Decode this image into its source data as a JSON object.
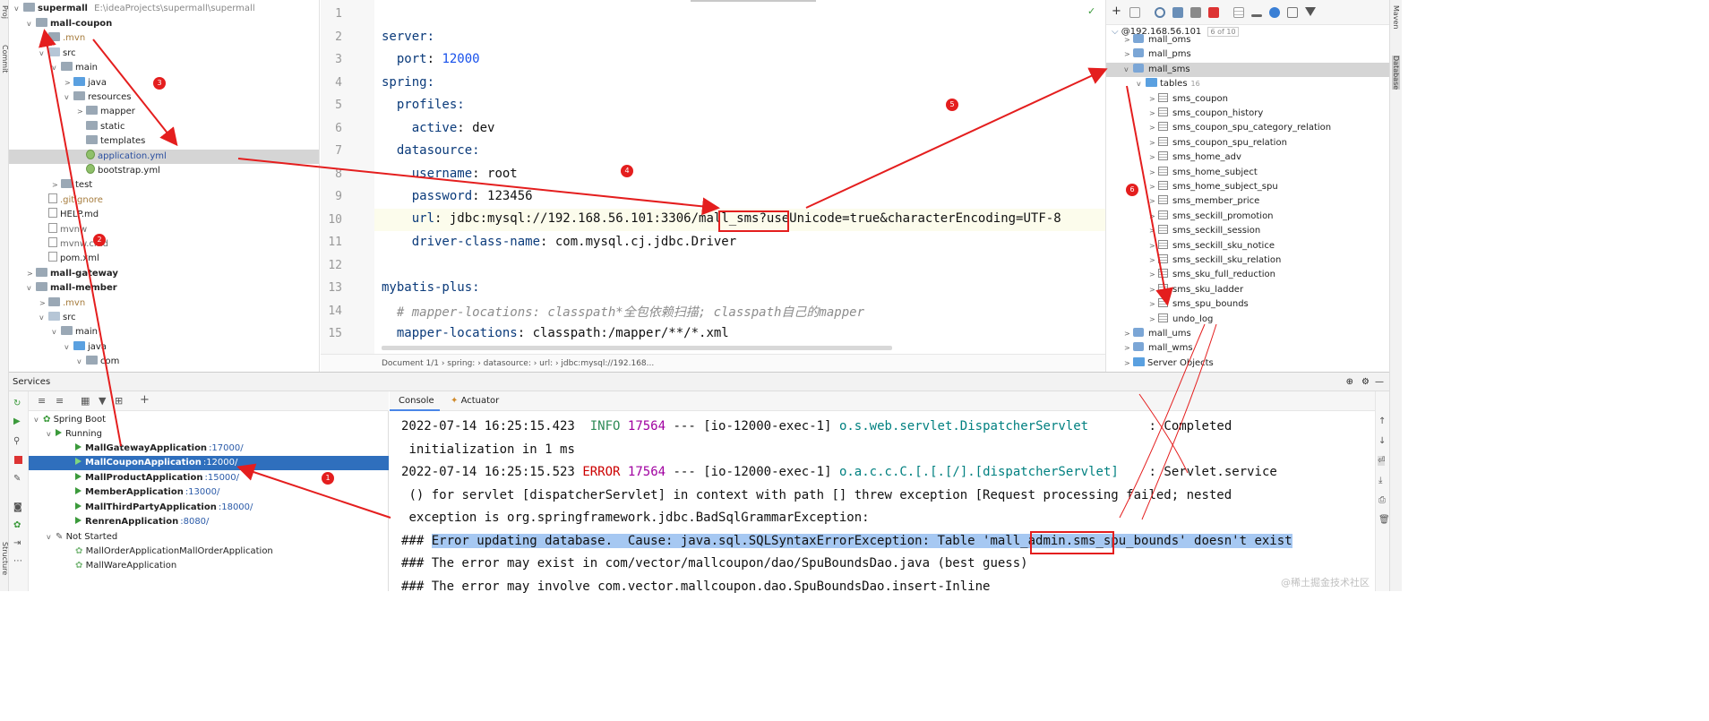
{
  "left_strip": {
    "project": "Proj",
    "commit": "Commit",
    "structure": "Structure"
  },
  "right_strip": {
    "maven": "Maven",
    "database": "Database"
  },
  "project_tree": {
    "root_name": "supermall",
    "root_path": "E:\\ideaProjects\\supermall\\supermall",
    "items": [
      {
        "label": "mall-coupon",
        "depth": 1,
        "kind": "module",
        "arrow": "v",
        "bold": true
      },
      {
        "label": ".mvn",
        "depth": 2,
        "kind": "folder",
        "arrow": "",
        "color": "#a67c3d"
      },
      {
        "label": "src",
        "depth": 2,
        "kind": "srcfolder",
        "arrow": "v"
      },
      {
        "label": "main",
        "depth": 3,
        "kind": "folder",
        "arrow": "v"
      },
      {
        "label": "java",
        "depth": 4,
        "kind": "bluefolder",
        "arrow": ">"
      },
      {
        "label": "resources",
        "depth": 4,
        "kind": "folder",
        "arrow": "v"
      },
      {
        "label": "mapper",
        "depth": 5,
        "kind": "folder",
        "arrow": ">"
      },
      {
        "label": "static",
        "depth": 5,
        "kind": "folder",
        "arrow": ""
      },
      {
        "label": "templates",
        "depth": 5,
        "kind": "folder",
        "arrow": ""
      },
      {
        "label": "application.yml",
        "depth": 5,
        "kind": "yml",
        "arrow": "",
        "selected": true,
        "color": "#2a4fa0"
      },
      {
        "label": "bootstrap.yml",
        "depth": 5,
        "kind": "yml",
        "arrow": ""
      },
      {
        "label": "test",
        "depth": 3,
        "kind": "folder",
        "arrow": ">"
      },
      {
        "label": ".gitignore",
        "depth": 2,
        "kind": "file",
        "arrow": "",
        "color": "#a67c3d"
      },
      {
        "label": "HELP.md",
        "depth": 2,
        "kind": "file",
        "arrow": ""
      },
      {
        "label": "mvnw",
        "depth": 2,
        "kind": "file",
        "arrow": "",
        "color": "#6b6b6b"
      },
      {
        "label": "mvnw.cmd",
        "depth": 2,
        "kind": "file",
        "arrow": "",
        "color": "#6b6b6b"
      },
      {
        "label": "pom.xml",
        "depth": 2,
        "kind": "file",
        "arrow": ""
      },
      {
        "label": "mall-gateway",
        "depth": 1,
        "kind": "module",
        "arrow": ">",
        "bold": true
      },
      {
        "label": "mall-member",
        "depth": 1,
        "kind": "module",
        "arrow": "v",
        "bold": true
      },
      {
        "label": ".mvn",
        "depth": 2,
        "kind": "folder",
        "arrow": ">",
        "color": "#a67c3d"
      },
      {
        "label": "src",
        "depth": 2,
        "kind": "srcfolder",
        "arrow": "v"
      },
      {
        "label": "main",
        "depth": 3,
        "kind": "folder",
        "arrow": "v"
      },
      {
        "label": "java",
        "depth": 4,
        "kind": "bluefolder",
        "arrow": "v"
      },
      {
        "label": "com",
        "depth": 5,
        "kind": "folder",
        "arrow": "v"
      }
    ]
  },
  "editor": {
    "line_numbers": [
      "1",
      "2",
      "3",
      "4",
      "5",
      "6",
      "7",
      "8",
      "9",
      "10",
      "11",
      "12",
      "13",
      "14",
      "15"
    ],
    "lines": {
      "l2": "server:",
      "l3k": "port",
      "l3v": "12000",
      "l4": "spring:",
      "l5": "profiles:",
      "l6k": "active",
      "l6v": "dev",
      "l7": "datasource:",
      "l8k": "username",
      "l8v": "root",
      "l9k": "password",
      "l9v": "123456",
      "l10k": "url",
      "l10a": "jdbc:mysql://192.168.56.101:3306/",
      "l10b": "mall_sms",
      "l10c": "?useUnicode=true&characterEncoding=UTF-8",
      "l11k": "driver-class-name",
      "l11v": "com.mysql.cj.jdbc.Driver",
      "l13": "mybatis-plus:",
      "l14": "# mapper-locations: classpath*全包依赖扫描; classpath自己的mapper",
      "l15k": "mapper-locations",
      "l15v": "classpath:/mapper/**/*.xml"
    },
    "breadcrumb": "Document 1/1  ›  spring:  ›  datasource:  ›  url:  ›  jdbc:mysql://192.168..."
  },
  "database": {
    "host": "@192.168.56.101",
    "count": "6 of 10",
    "schemas_top": [
      "mall_oms",
      "mall_pms"
    ],
    "selected_schema": "mall_sms",
    "tables_label": "tables",
    "tables_count": "16",
    "tables": [
      "sms_coupon",
      "sms_coupon_history",
      "sms_coupon_spu_category_relation",
      "sms_coupon_spu_relation",
      "sms_home_adv",
      "sms_home_subject",
      "sms_home_subject_spu",
      "sms_member_price",
      "sms_seckill_promotion",
      "sms_seckill_session",
      "sms_seckill_sku_notice",
      "sms_seckill_sku_relation",
      "sms_sku_full_reduction",
      "sms_sku_ladder",
      "sms_spu_bounds",
      "undo_log"
    ],
    "schemas_bottom": [
      "mall_ums",
      "mall_wms"
    ],
    "server_objects": "Server Objects"
  },
  "services": {
    "title": "Services",
    "spring_boot": "Spring Boot",
    "running": "Running",
    "apps_running": [
      {
        "name": "MallGatewayApplication",
        "port": ":17000/"
      },
      {
        "name": "MallCouponApplication",
        "port": ":12000/",
        "selected": true
      },
      {
        "name": "MallProductApplication",
        "port": ":15000/"
      },
      {
        "name": "MemberApplication",
        "port": ":13000/"
      },
      {
        "name": "MallThirdPartyApplication",
        "port": ":18000/"
      },
      {
        "name": "RenrenApplication",
        "port": ":8080/"
      }
    ],
    "not_started": "Not Started",
    "apps_stopped": [
      "MallOrderApplicationMallOrderApplication",
      "MallWareApplication"
    ]
  },
  "console": {
    "tabs": [
      "Console",
      "Actuator"
    ],
    "l1_ts": "2022-07-14 16:25:15.423",
    "l1_level": "INFO",
    "l1_pid": "17564",
    "l1_mid": "--- [io-12000-exec-1]",
    "l1_cls": "o.s.web.servlet.DispatcherServlet",
    "l1_msg": ": Completed",
    "l2": "initialization in 1 ms",
    "l3_ts": "2022-07-14 16:25:15.523",
    "l3_level": "ERROR",
    "l3_pid": "17564",
    "l3_mid": "--- [io-12000-exec-1]",
    "l3_cls": "o.a.c.c.C.[.[.[/].[dispatcherServlet]",
    "l3_msg": ": Servlet.service",
    "l4": "() for servlet [dispatcherServlet] in context with path [] threw exception [Request processing failed; nested",
    "l5": "exception is org.springframework.jdbc.BadSqlGrammarException:",
    "l6_pre": "### ",
    "l6_sel": "Error updating database.  Cause: java.sql.SQLSyntaxErrorException: Table 'mall_admin.sms_spu_bounds' doesn't exist",
    "l7": "### The error may exist in com/vector/mallcoupon/dao/SpuBoundsDao.java (best guess)",
    "l8": "### The error may involve com.vector.mallcoupon.dao.SpuBoundsDao.insert-Inline"
  },
  "annotations": [
    "1",
    "2",
    "3",
    "4",
    "5",
    "6"
  ],
  "watermark": "@稀土掘金技术社区",
  "colors": {
    "annotation_red": "#e41e1e",
    "selection_blue": "#2f6fbd",
    "error_highlight": "#a6c8f2"
  }
}
